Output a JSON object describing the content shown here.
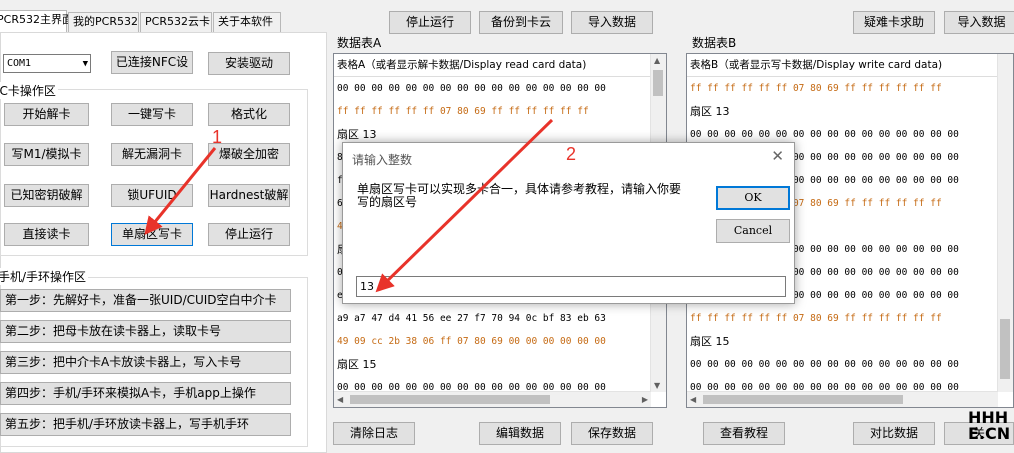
{
  "tabs": [
    "PCR532主界面",
    "我的PCR532",
    "PCR532云卡",
    "关于本软件"
  ],
  "top_toolbar": {
    "stop": "停止运行",
    "backup": "备份到卡云",
    "import": "导入数据",
    "help": "疑难卡求助",
    "import2": "导入数据"
  },
  "port": {
    "value": "COM1",
    "connect": "已连接NFC设",
    "install": "安装驱动"
  },
  "ic_group": {
    "title": "IC卡操作区",
    "buttons": [
      [
        "开始解卡",
        "一键写卡",
        "格式化"
      ],
      [
        "写M1/模拟卡",
        "解无漏洞卡",
        "爆破全加密"
      ],
      [
        "已知密钥破解",
        "锁UFUID",
        "Hardnest破解"
      ],
      [
        "直接读卡",
        "单扇区写卡",
        "停止运行"
      ]
    ]
  },
  "phone_group": {
    "title": "手机/手环操作区",
    "steps": [
      "第一步：先解好卡，准备一张UID/CUID空白中介卡",
      "第二步：把母卡放在读卡器上，读取卡号",
      "第三步：把中介卡A卡放读卡器上，写入卡号",
      "第四步：手机/手环来模拟A卡，手机app上操作",
      "第五步：把手机/手环放读卡器上，写手机手环"
    ]
  },
  "table_a": {
    "title": "数据表A",
    "header": "表格A（或者显示解卡数据/Display read card data)",
    "rows": [
      {
        "t": "00 00 00 00 00 00 00 00 00 00 00 00 00 00 00 00",
        "c": "hex"
      },
      {
        "t": "ff ff ff ff ff ff 07 80 69 ff ff ff ff ff ff",
        "c": "orange"
      },
      {
        "t": "扇区 13",
        "c": "cn"
      },
      {
        "t": "8",
        "c": "hex"
      },
      {
        "t": "f",
        "c": "hex"
      },
      {
        "t": "6",
        "c": "hex"
      },
      {
        "t": "4",
        "c": "orange"
      },
      {
        "t": "扇",
        "c": "cn"
      },
      {
        "t": "0",
        "c": "hex"
      },
      {
        "t": "e",
        "c": "hex"
      },
      {
        "t": "a9 a7 47 d4 41 56 ee 27 f7 70 94 0c bf 83 eb 63",
        "c": "hex"
      },
      {
        "t": "49 09 cc 2b 38 06 ff 07 80 69 00 00 00 00 00 00",
        "c": "orange"
      },
      {
        "t": "扇区 15",
        "c": "cn"
      },
      {
        "t": "00 00 00 00 00 00 00 00 00 00 00 00 00 00 00 00",
        "c": "hex"
      }
    ]
  },
  "table_b": {
    "title": "数据表B",
    "header": "表格B（或者显示写卡数据/Display write card data)",
    "rows": [
      {
        "t": "ff ff ff ff ff ff 07 80 69 ff ff ff ff ff ff",
        "c": "orange"
      },
      {
        "t": "扇区 13",
        "c": "cn"
      },
      {
        "t": "00 00 00 00 00 00 00 00 00 00 00 00 00 00 00 00",
        "c": "hex"
      },
      {
        "t": "00 00 00 00 00 00 00 00 00 00 00 00 00 00 00 00",
        "c": "hex"
      },
      {
        "t": "00 00 00 00 00 00 00 00 00 00 00 00 00 00 00 00",
        "c": "hex"
      },
      {
        "t": "ff ff ff ff ff ff 07 80 69 ff ff ff ff ff ff",
        "c": "orange"
      },
      {
        "t": "扇区",
        "c": "cn"
      },
      {
        "t": "00 00 00 00 00 00 00 00 00 00 00 00 00 00 00 00",
        "c": "hex"
      },
      {
        "t": "00 00 00 00 00 00 00 00 00 00 00 00 00 00 00 00",
        "c": "hex"
      },
      {
        "t": "00 00 00 00 00 00 00 00 00 00 00 00 00 00 00 00",
        "c": "hex"
      },
      {
        "t": "ff ff ff ff ff ff 07 80 69 ff ff ff ff ff ff",
        "c": "orange"
      },
      {
        "t": "扇区 15",
        "c": "cn"
      },
      {
        "t": "00 00 00 00 00 00 00 00 00 00 00 00 00 00 00 00",
        "c": "hex"
      },
      {
        "t": "00 00 00 00 00 00 00 00 00 00 00 00 00 00 00 00",
        "c": "hex"
      }
    ]
  },
  "bottom_toolbar": {
    "clear_log": "清除日志",
    "edit": "编辑数据",
    "save": "保存数据",
    "tutorial": "查看教程",
    "compare": "对比数据",
    "last": "关"
  },
  "dialog": {
    "title": "请输入整数",
    "message": "单扇区写卡可以实现多卡合一，具体请参考教程，请输入你要写的扇区号",
    "ok": "OK",
    "cancel": "Cancel",
    "input_value": "13",
    "close": "✕"
  },
  "annotations": {
    "label1": "1",
    "label2": "2",
    "color": "#e8332a"
  },
  "watermark": {
    "line1": "HHH",
    "line2": "E.CN"
  }
}
